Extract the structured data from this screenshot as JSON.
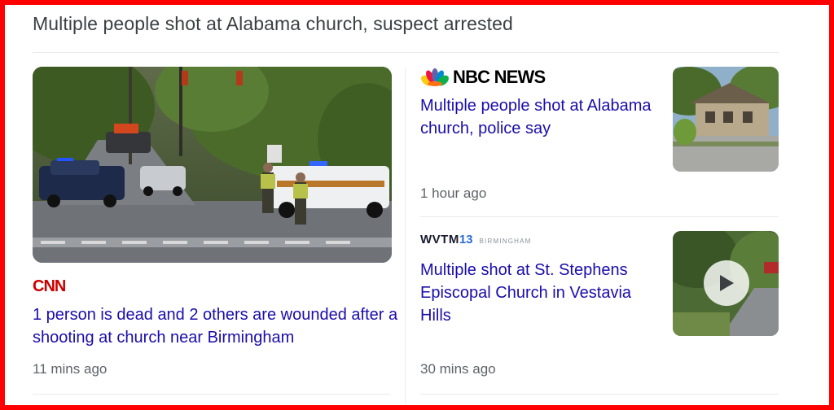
{
  "story": {
    "headline": "Multiple people shot at Alabama church, suspect arrested"
  },
  "articles": [
    {
      "source": "CNN",
      "title": "1 person is dead and 2 others are wounded after a shooting at church near Birmingham",
      "time": "11 mins ago",
      "has_video": false
    },
    {
      "source": "NBC NEWS",
      "title": "Multiple people shot at Alabama church, police say",
      "time": "1 hour ago",
      "has_video": false
    },
    {
      "source_main": "WVTM",
      "source_num": "13",
      "source_sub": "BIRMINGHAM",
      "title": "Multiple shot at St. Stephens Episcopal Church in Vestavia Hills",
      "time": "30 mins ago",
      "has_video": true
    }
  ],
  "colors": {
    "frame": "#ff0000",
    "link": "#1a0dab",
    "meta": "#5f6368",
    "headline": "#3c4043",
    "cnn_red": "#cc0000"
  },
  "icons": [
    "peacock-icon",
    "play-icon"
  ]
}
